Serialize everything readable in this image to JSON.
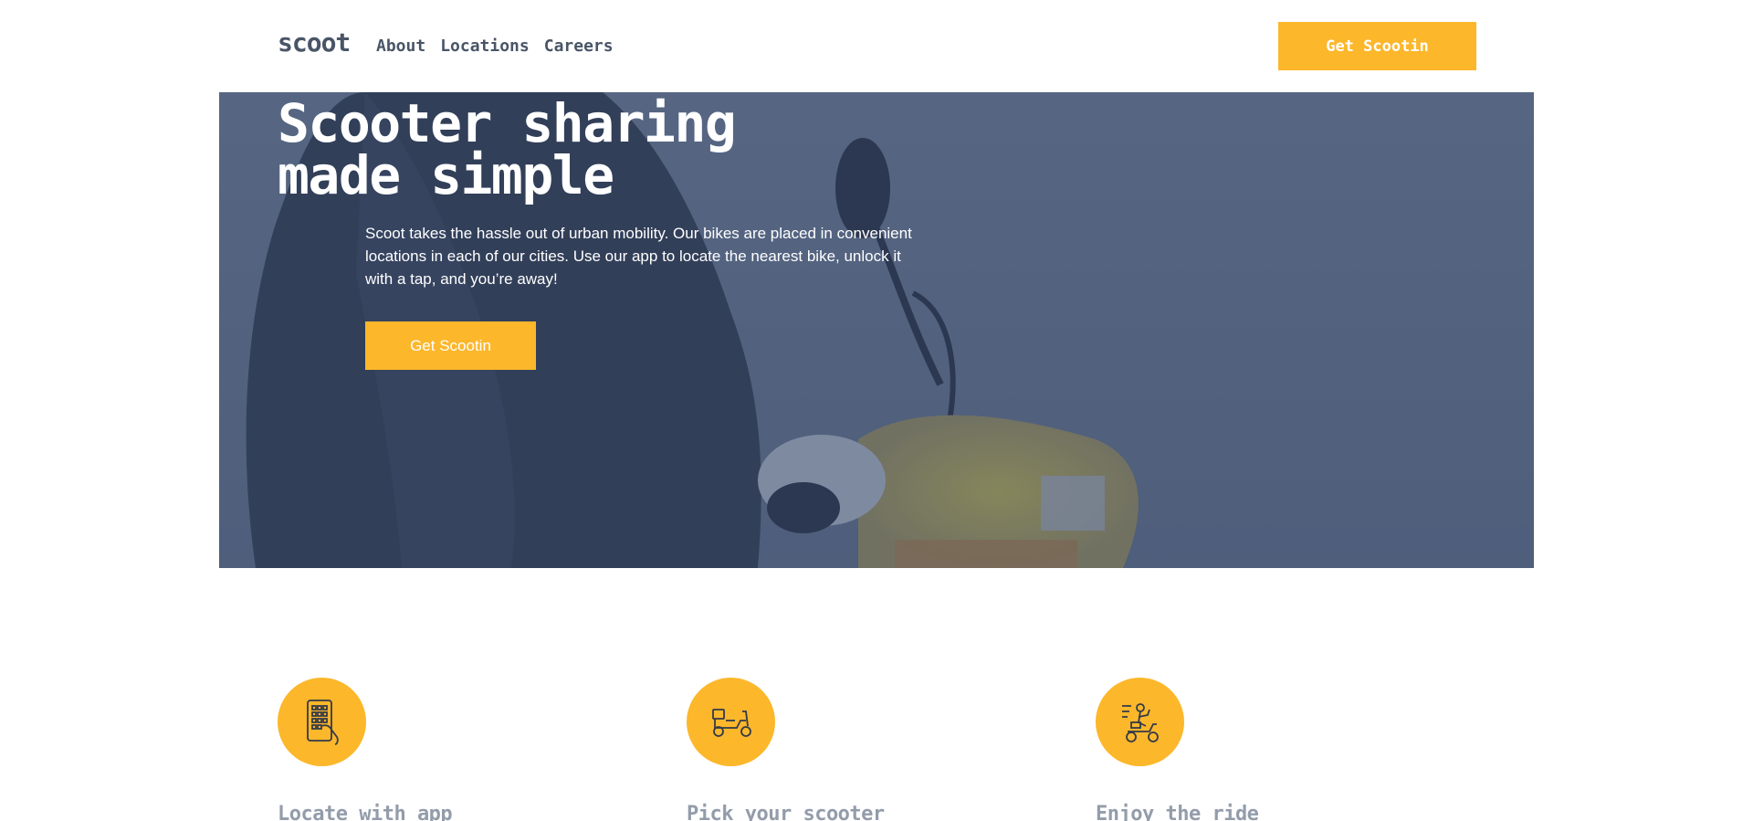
{
  "brand": {
    "logo": "scoot"
  },
  "nav": {
    "items": [
      {
        "label": "About"
      },
      {
        "label": "Locations"
      },
      {
        "label": "Careers"
      }
    ],
    "cta_label": "Get Scootin"
  },
  "hero": {
    "title_line1": "Scooter sharing",
    "title_line2": "made simple",
    "text": "Scoot takes the hassle out of urban mobility. Our bikes are placed in convenient locations in each of our cities. Use our app to locate the nearest bike, unlock it with a tap, and you’re away!",
    "cta_label": "Get Scootin",
    "image": "person-on-yellow-scooter-photo"
  },
  "features": [
    {
      "icon": "phone-app-icon",
      "title": "Locate with app"
    },
    {
      "icon": "scooter-icon",
      "title": "Pick your scooter"
    },
    {
      "icon": "scooter-ride-icon",
      "title": "Enjoy the ride"
    }
  ],
  "colors": {
    "accent": "#fcb72b",
    "text_dark": "#495567",
    "hero_overlay": "#364869",
    "feature_title": "#939caa"
  }
}
